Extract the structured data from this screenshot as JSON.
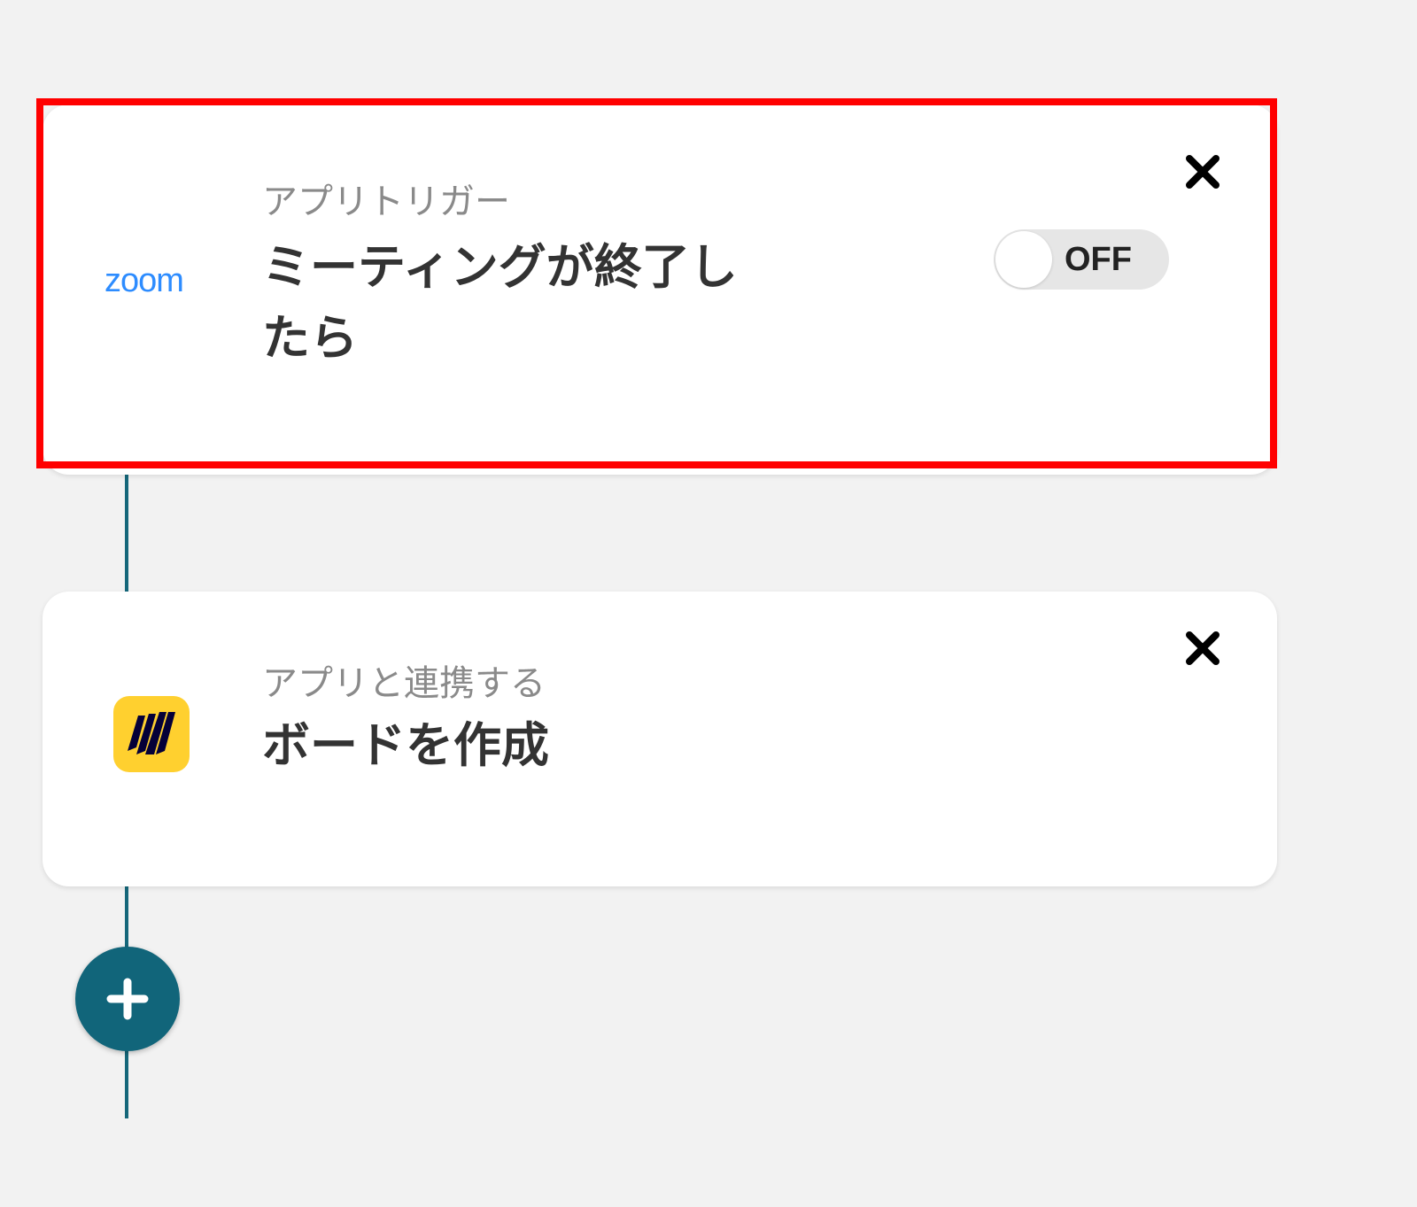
{
  "flow": {
    "trigger": {
      "app_logo_text": "zoom",
      "app_icon": "zoom-logo",
      "subtitle": "アプリトリガー",
      "title": "ミーティングが終了したら",
      "toggle": {
        "label": "OFF",
        "state": "off"
      },
      "close_icon": "close-icon",
      "highlighted": true
    },
    "action": {
      "app_icon": "miro-logo",
      "subtitle": "アプリと連携する",
      "title": "ボードを作成",
      "close_icon": "close-icon"
    },
    "add_step_icon": "plus-icon"
  },
  "colors": {
    "background": "#f2f2f2",
    "connector": "#15677a",
    "add_button": "#11657a",
    "highlight_border": "#ff0000",
    "zoom_blue": "#2d8cff",
    "miro_yellow": "#ffd02f",
    "miro_dark": "#050038",
    "toggle_track": "#e6e6e6"
  }
}
